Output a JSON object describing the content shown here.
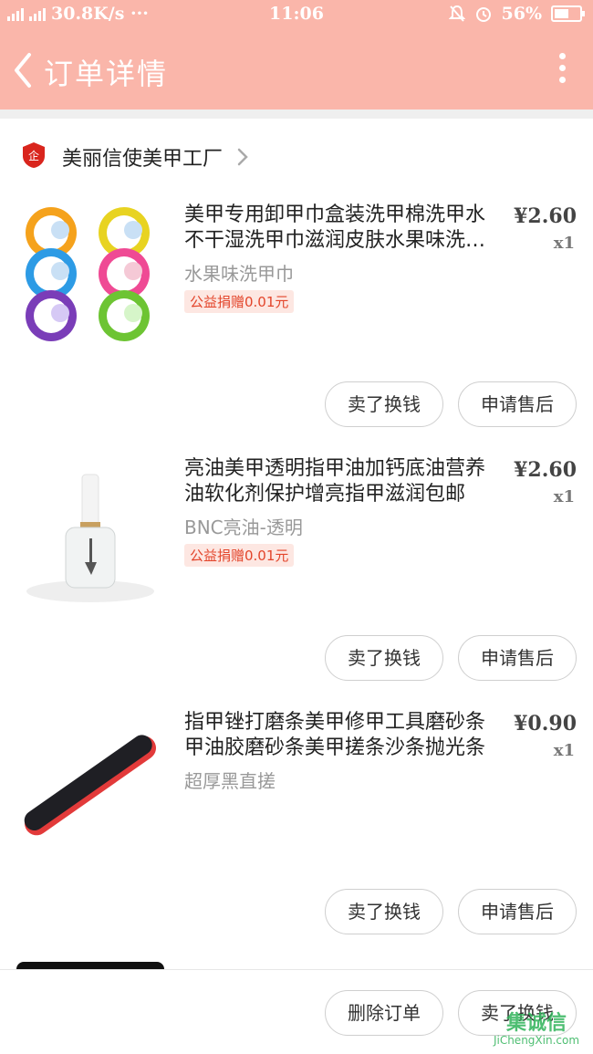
{
  "status_bar": {
    "network": "4G",
    "speed": "30.8K/s ···",
    "time": "11:06",
    "battery_percent": "56%",
    "battery_level": 0.56
  },
  "header": {
    "title": "订单详情",
    "back_icon": "chevron-left-icon",
    "more_icon": "more-vertical-icon"
  },
  "shop": {
    "name": "美丽信使美甲工厂",
    "logo_text": "企"
  },
  "items": [
    {
      "name": "美甲专用卸甲巾盒装洗甲棉洗甲水不干湿洗甲巾滋润皮肤水果味洗甲巾",
      "sku": "水果味洗甲巾",
      "badge": "公益捐赠0.01元",
      "price": "¥2.60",
      "qty": "x1",
      "btn_sell": "卖了换钱",
      "btn_after": "申请售后"
    },
    {
      "name": "亮油美甲透明指甲油加钙底油营养油软化剂保护增亮指甲滋润包邮",
      "sku": "BNC亮油-透明",
      "badge": "公益捐赠0.01元",
      "price": "¥2.60",
      "qty": "x1",
      "btn_sell": "卖了换钱",
      "btn_after": "申请售后"
    },
    {
      "name": "指甲锉打磨条美甲修甲工具磨砂条甲油胶磨砂条美甲搓条沙条抛光条",
      "sku": "超厚黑直搓",
      "badge": "",
      "price": "¥0.90",
      "qty": "x1",
      "btn_sell": "卖了换钱",
      "btn_after": "申请售后"
    }
  ],
  "bottom_bar": {
    "delete_label": "删除订单",
    "sell_label": "卖了换钱"
  },
  "watermark": {
    "text": "集诚信",
    "sub": "JiChengXin.com"
  }
}
